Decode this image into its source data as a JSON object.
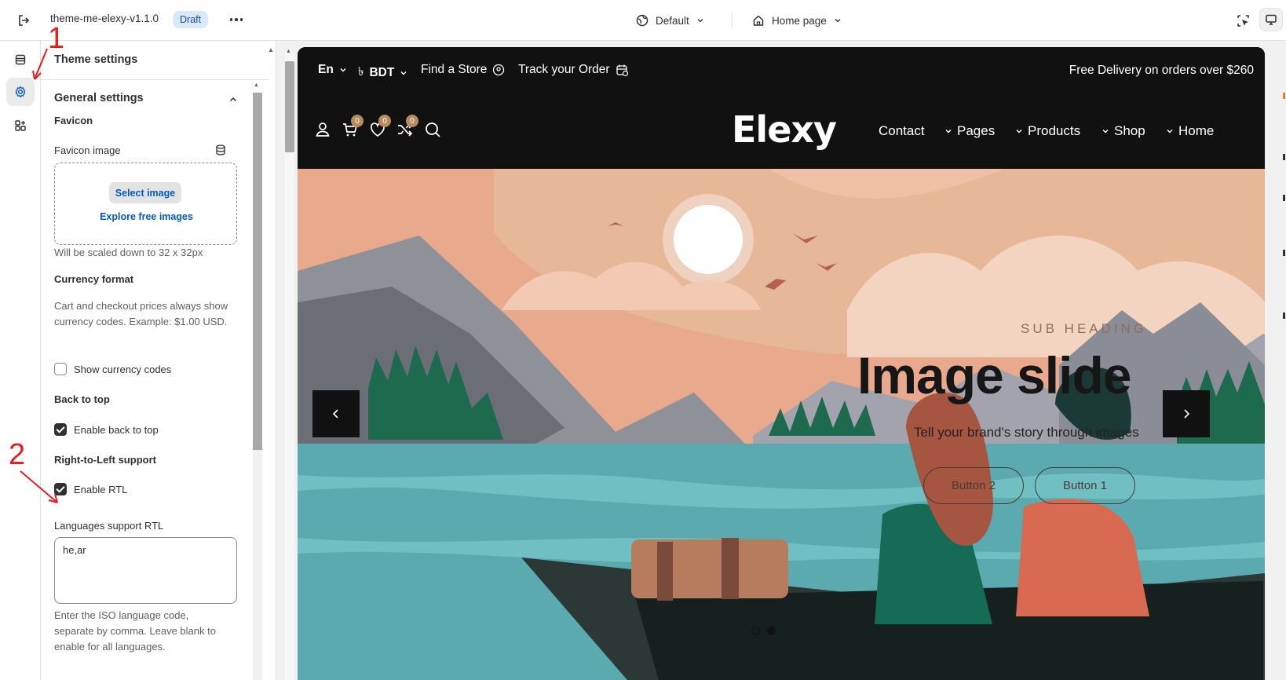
{
  "topbar": {
    "theme_name": "theme-me-elexy-v1.1.0",
    "status_badge": "Draft",
    "preset_select": "Default",
    "page_select": "Home page"
  },
  "rail": {
    "items": [
      "sections",
      "theme-settings",
      "apps"
    ],
    "active": "theme-settings"
  },
  "panel": {
    "title": "Theme settings",
    "section_title": "General settings",
    "favicon": {
      "heading": "Favicon",
      "label": "Favicon image",
      "select_button": "Select image",
      "explore_link": "Explore free images",
      "help": "Will be scaled down to 32 x 32px"
    },
    "currency": {
      "heading": "Currency format",
      "help": "Cart and checkout prices always show currency codes. Example: $1.00 USD.",
      "checkbox_label": "Show currency codes",
      "checked": false
    },
    "back_to_top": {
      "heading": "Back to top",
      "checkbox_label": "Enable back to top",
      "checked": true
    },
    "rtl": {
      "heading": "Right-to-Left support",
      "checkbox_label": "Enable RTL",
      "checked": true,
      "languages_label": "Languages support RTL",
      "languages_value": "he,ar",
      "languages_help": "Enter the ISO language code, separate by comma. Leave blank to enable for all languages."
    }
  },
  "preview": {
    "announcement": {
      "language": "En",
      "currency": "BDT",
      "find_store": "Find a Store",
      "track_order": "Track your Order",
      "free_delivery": "Free Delivery on orders over $260"
    },
    "header": {
      "logo": "Elexy",
      "cart_count": "0",
      "wishlist_count": "0",
      "compare_count": "0",
      "nav": [
        "Contact",
        "Pages",
        "Products",
        "Shop",
        "Home"
      ]
    },
    "hero": {
      "sub_heading": "SUB HEADING",
      "title": "Image slide",
      "text": "Tell your brand's story through images",
      "button_2": "Button 2",
      "button_1": "Button 1",
      "slide_count": 2,
      "active_slide": 2
    }
  },
  "annotations": {
    "marker_1": "1",
    "marker_2": "2"
  },
  "colors": {
    "accent_blue": "#005bd3",
    "badge_bg": "#d9e9fb",
    "annotation_red": "#e81c1c",
    "preview_dark": "#111111",
    "counter_badge": "#b88c5a"
  }
}
